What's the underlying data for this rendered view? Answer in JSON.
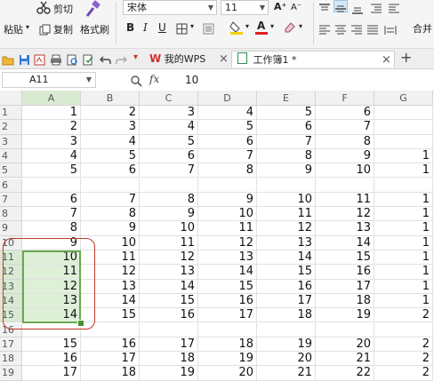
{
  "ribbon": {
    "cut_label": "剪切",
    "paste_label": "粘贴",
    "copy_label": "复制",
    "format_painter_label": "格式刷",
    "font_name": "宋体",
    "font_size": "11",
    "bold_label": "B",
    "italic_label": "I",
    "underline_label": "U",
    "font_color_letter": "A",
    "grow_font_label": "A⁺",
    "shrink_font_label": "A⁻",
    "merge_label": "合并",
    "accent_color": "#1e8f3c"
  },
  "tabs": {
    "wps_label": "我的WPS",
    "workbook_label": "工作簿1 *",
    "close_glyph": "×",
    "add_glyph": "+"
  },
  "formula_bar": {
    "name_box": "A11",
    "fx_label": "fx",
    "value": "10"
  },
  "columns": [
    "A",
    "B",
    "C",
    "D",
    "E",
    "F",
    "G"
  ],
  "rows": [
    {
      "label": "1",
      "cells": [
        "1",
        "2",
        "3",
        "4",
        "5",
        "6",
        ""
      ]
    },
    {
      "label": "2",
      "cells": [
        "2",
        "3",
        "4",
        "5",
        "6",
        "7",
        ""
      ]
    },
    {
      "label": "3",
      "cells": [
        "3",
        "4",
        "5",
        "6",
        "7",
        "8",
        ""
      ]
    },
    {
      "label": "4",
      "cells": [
        "4",
        "5",
        "6",
        "7",
        "8",
        "9",
        "1"
      ]
    },
    {
      "label": "5",
      "cells": [
        "5",
        "6",
        "7",
        "8",
        "9",
        "10",
        "1"
      ]
    },
    {
      "label": "6",
      "cells": [
        "",
        "",
        "",
        "",
        "",
        "",
        ""
      ]
    },
    {
      "label": "7",
      "cells": [
        "6",
        "7",
        "8",
        "9",
        "10",
        "11",
        "1"
      ]
    },
    {
      "label": "8",
      "cells": [
        "7",
        "8",
        "9",
        "10",
        "11",
        "12",
        "1"
      ]
    },
    {
      "label": "9",
      "cells": [
        "8",
        "9",
        "10",
        "11",
        "12",
        "13",
        "1"
      ]
    },
    {
      "label": "10",
      "cells": [
        "9",
        "10",
        "11",
        "12",
        "13",
        "14",
        "1"
      ]
    },
    {
      "label": "11",
      "cells": [
        "10",
        "11",
        "12",
        "13",
        "14",
        "15",
        "1"
      ]
    },
    {
      "label": "12",
      "cells": [
        "11",
        "12",
        "13",
        "14",
        "15",
        "16",
        "1"
      ]
    },
    {
      "label": "13",
      "cells": [
        "12",
        "13",
        "14",
        "15",
        "16",
        "17",
        "1"
      ]
    },
    {
      "label": "14",
      "cells": [
        "13",
        "14",
        "15",
        "16",
        "17",
        "18",
        "1"
      ]
    },
    {
      "label": "15",
      "cells": [
        "14",
        "15",
        "16",
        "17",
        "18",
        "19",
        "2"
      ]
    },
    {
      "label": "16",
      "cells": [
        "",
        "",
        "",
        "",
        "",
        "",
        ""
      ]
    },
    {
      "label": "17",
      "cells": [
        "15",
        "16",
        "17",
        "18",
        "19",
        "20",
        "2"
      ]
    },
    {
      "label": "18",
      "cells": [
        "16",
        "17",
        "18",
        "19",
        "20",
        "21",
        "2"
      ]
    },
    {
      "label": "19",
      "cells": [
        "17",
        "18",
        "19",
        "20",
        "21",
        "22",
        "2"
      ]
    }
  ],
  "selection": {
    "col": "A",
    "first_row": "11",
    "last_row": "15"
  }
}
